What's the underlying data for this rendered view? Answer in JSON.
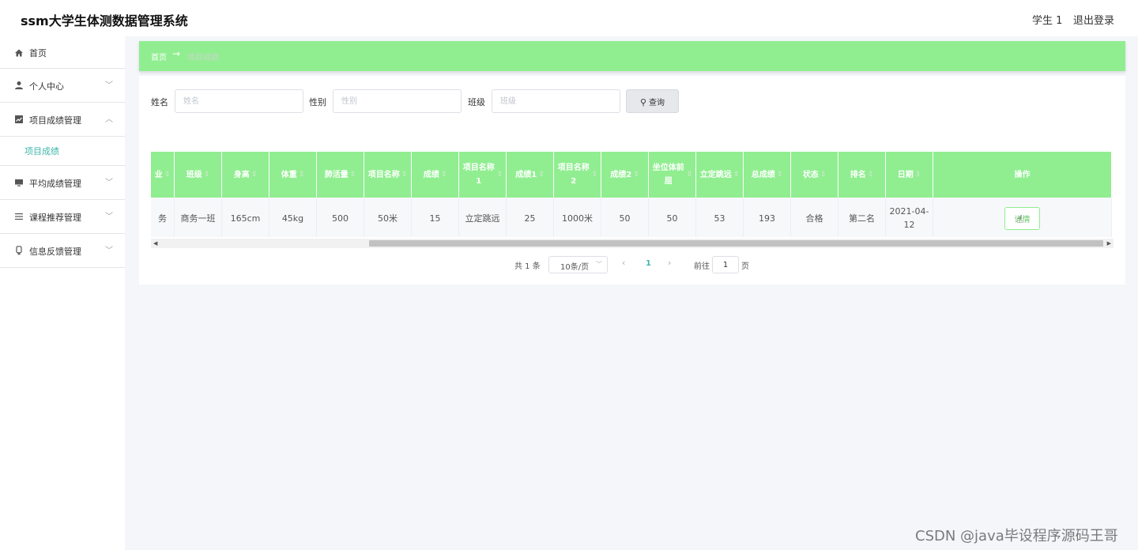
{
  "header": {
    "title": "ssm大学生体测数据管理系统",
    "user": "学生 1",
    "logout": "退出登录"
  },
  "sidebar": {
    "items": [
      {
        "label": "首页",
        "icon": "home-icon"
      },
      {
        "label": "个人中心",
        "icon": "user-icon"
      },
      {
        "label": "项目成绩管理",
        "icon": "chart-icon",
        "expanded": true,
        "children": [
          {
            "label": "项目成绩"
          }
        ]
      },
      {
        "label": "平均成绩管理",
        "icon": "monitor-icon"
      },
      {
        "label": "课程推荐管理",
        "icon": "list-icon"
      },
      {
        "label": "信息反馈管理",
        "icon": "feedback-icon"
      }
    ]
  },
  "breadcrumb": {
    "home": "首页",
    "arrow": "→",
    "current": "项目成绩"
  },
  "filters": {
    "name_label": "姓名",
    "name_placeholder": "姓名",
    "gender_label": "性别",
    "gender_placeholder": "性别",
    "class_label": "班级",
    "class_placeholder": "班级",
    "search_label": "查询"
  },
  "table": {
    "columns": [
      {
        "label": "业"
      },
      {
        "label": "班级"
      },
      {
        "label": "身高"
      },
      {
        "label": "体重"
      },
      {
        "label": "肺活量"
      },
      {
        "label": "项目名称"
      },
      {
        "label": "成绩"
      },
      {
        "label": "项目名称1"
      },
      {
        "label": "成绩1"
      },
      {
        "label": "项目名称2"
      },
      {
        "label": "成绩2"
      },
      {
        "label": "坐位体前屈"
      },
      {
        "label": "立定跳远"
      },
      {
        "label": "总成绩"
      },
      {
        "label": "状态"
      },
      {
        "label": "排名"
      },
      {
        "label": "日期"
      },
      {
        "label": "操作"
      }
    ],
    "rows": [
      {
        "cells": [
          "务",
          "商务一班",
          "165cm",
          "45kg",
          "500",
          "50米",
          "15",
          "立定跳远",
          "25",
          "1000米",
          "50",
          "50",
          "53",
          "193",
          "合格",
          "第二名",
          "2021-04-12"
        ],
        "action": "详情"
      }
    ]
  },
  "pagination": {
    "total": "共 1 条",
    "page_size": "10条/页",
    "current_page": "1",
    "goto_label": "前往",
    "goto_value": "1",
    "page_unit": "页"
  },
  "watermark": "CSDN @java毕设程序源码王哥",
  "colors": {
    "accent_green": "#90ee90",
    "active_teal": "#3fb6a8"
  }
}
